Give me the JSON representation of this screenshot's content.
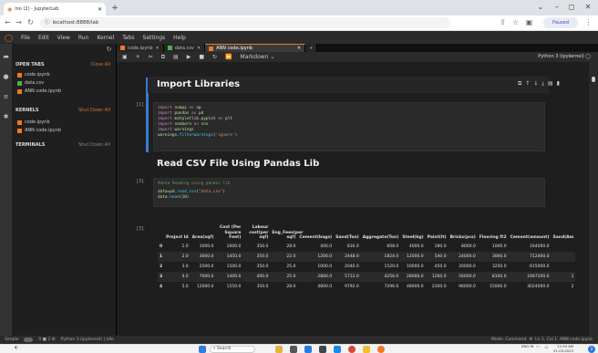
{
  "browser": {
    "tab_title": "ino (2) - JupyterLab",
    "url": "localhost:8888/lab",
    "profile_label": "Paused",
    "minimize": "–",
    "maximize": "◻",
    "close": "✕"
  },
  "menu": [
    "File",
    "Edit",
    "View",
    "Run",
    "Kernel",
    "Tabs",
    "Settings",
    "Help"
  ],
  "sidebar": {
    "open_tabs_header": "OPEN TABS",
    "open_tabs_action": "Close All",
    "open_tabs": [
      "code.ipynb",
      "data.csv",
      "ANN code.ipynb"
    ],
    "kernels_header": "KERNELS",
    "kernels_action": "Shut Down All",
    "kernels": [
      "code.ipynb",
      "ANN code.ipynb"
    ],
    "terminals_header": "TERMINALS",
    "terminals_action": "Shut Down All"
  },
  "doc_tabs": [
    "code.ipynb",
    "data.csv",
    "ANN code.ipynb"
  ],
  "toolbar": {
    "cell_type": "Markdown",
    "kernel": "Python 3 (ipykernel)"
  },
  "notebook": {
    "heading1": "Import Libraries",
    "prompt1": "[1]:",
    "code1": [
      "import numpy as np",
      "import pandas as pd",
      "import matplotlib.pyplot as plt",
      "import seaborn as sns",
      "import warnings",
      "warnings.filterwarnings('ignore')"
    ],
    "heading2": "Read CSV File Using Pandas Lib",
    "prompt2": "[3]:",
    "code2": [
      "#data Reading using pandas lib",
      "data=pd.read_csv(\"data.csv\")",
      "data.head(10)"
    ],
    "prompt3": "[3]:"
  },
  "table": {
    "columns": [
      "",
      "Project Id",
      "Area(sqf)",
      "Cost (Per Square Feet)",
      "Labour cost(per sqf)",
      "Eng_Fees(per sqf)",
      "Cement(bags)",
      "Sand(Ton)",
      "Aggregate(Ton)",
      "Steel(kg)",
      "Paint(lt)",
      "Bricks(pcs)",
      "Flooring ft2",
      "Cement(amount)",
      "Sand(Am"
    ],
    "rows": [
      [
        "0",
        "1.0",
        "1000.0",
        "1000.0",
        "350.0",
        "28.0",
        "400.0",
        "816.0",
        "608.0",
        "4000.0",
        "180.0",
        "8000.0",
        "1000.0",
        "164000.0",
        ""
      ],
      [
        "1",
        "2.0",
        "3000.0",
        "1450.0",
        "350.0",
        "22.0",
        "1200.0",
        "2448.0",
        "1824.0",
        "12000.0",
        "540.0",
        "24000.0",
        "3000.0",
        "712400.0",
        ""
      ],
      [
        "2",
        "3.0",
        "2500.0",
        "1500.0",
        "350.0",
        "25.0",
        "1000.0",
        "2040.0",
        "1520.0",
        "10000.0",
        "450.0",
        "20000.0",
        "3250.0",
        "615000.0",
        ""
      ],
      [
        "3",
        "4.0",
        "7000.0",
        "1400.0",
        "400.0",
        "25.0",
        "2800.0",
        "5712.0",
        "4256.0",
        "28000.0",
        "1260.0",
        "56000.0",
        "8100.0",
        "1697200.0",
        "1"
      ],
      [
        "4",
        "5.0",
        "12000.0",
        "1550.0",
        "350.0",
        "28.0",
        "4800.0",
        "9792.0",
        "7296.0",
        "48000.0",
        "2160.0",
        "96000.0",
        "15000.0",
        "3024000.0",
        "2"
      ]
    ]
  },
  "statusbar": {
    "mode_label": "Simple",
    "counts": "0  ■  2  ⚙",
    "kernel_status": "Python 3 (ipykernel) | Idle",
    "mode": "Mode: Command",
    "cursor": "Ln 1, Col 1",
    "file": "ANN code.ipynb"
  },
  "taskbar": {
    "search": "Search",
    "lang": "ENG IN",
    "time": "12:39 AM",
    "date": "21-03-2023"
  }
}
